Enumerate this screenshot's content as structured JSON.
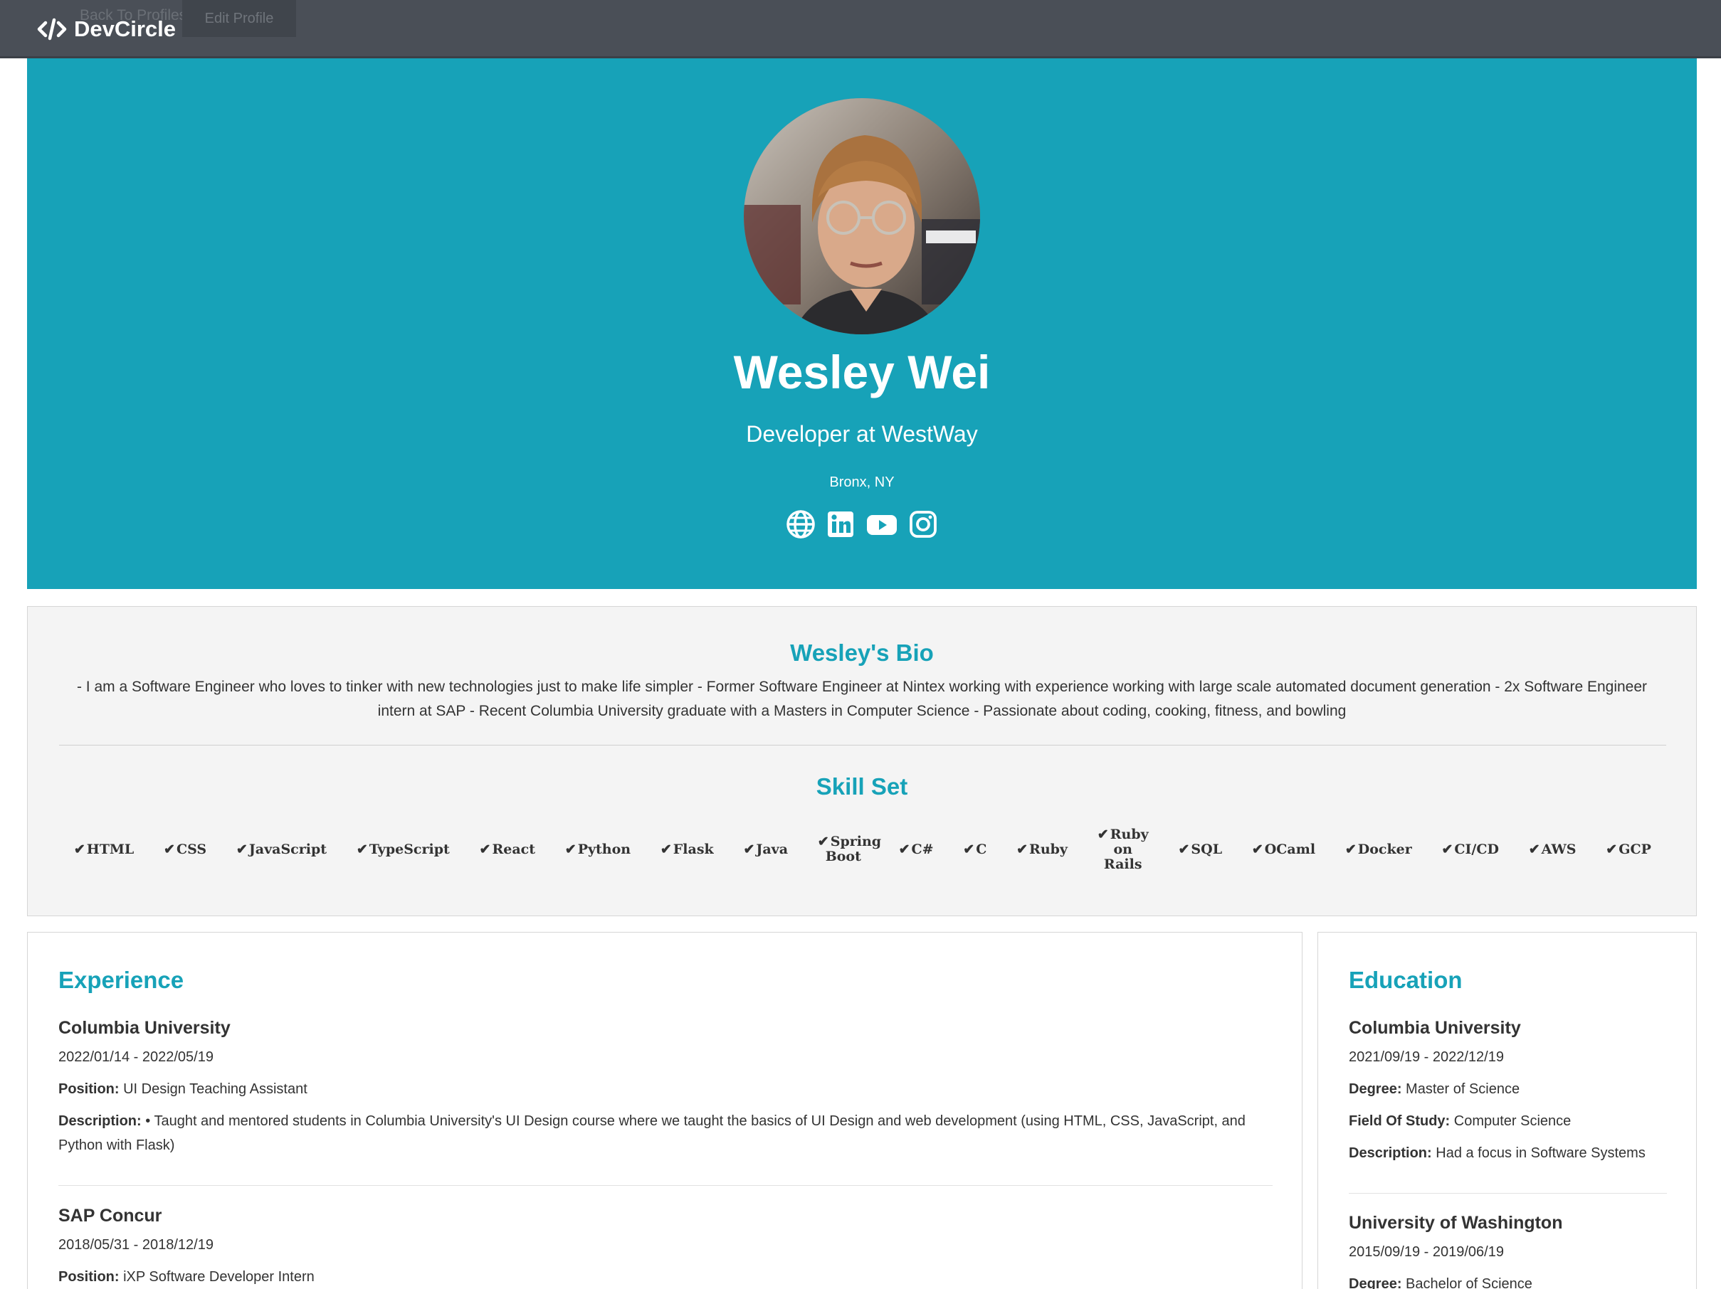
{
  "nav": {
    "brand": "DevCircle",
    "ghost_link": "Back To Profiles",
    "edit_button": "Edit Profile"
  },
  "profile": {
    "name": "Wesley Wei",
    "headline": "Developer at WestWay",
    "location": "Bronx, NY",
    "socials": [
      "globe-icon",
      "linkedin-icon",
      "youtube-icon",
      "instagram-icon"
    ]
  },
  "bio": {
    "title": "Wesley's Bio",
    "text": "- I am a Software Engineer who loves to tinker with new technologies just to make life simpler - Former Software Engineer at Nintex working with experience working with large scale automated document generation - 2x Software Engineer intern at SAP - Recent Columbia University graduate with a Masters in Computer Science - Passionate about coding, cooking, fitness, and bowling"
  },
  "skills": {
    "title": "Skill Set",
    "check": "✔",
    "items": [
      "HTML",
      "CSS",
      "JavaScript",
      "TypeScript",
      "React",
      "Python",
      "Flask",
      "Java",
      "Spring Boot",
      "C#",
      "C",
      "Ruby",
      "Ruby on Rails",
      "SQL",
      "OCaml",
      "Docker",
      "CI/CD",
      "AWS",
      "GCP"
    ]
  },
  "experience": {
    "title": "Experience",
    "position_label": "Position:",
    "description_label": "Description:",
    "items": [
      {
        "company": "Columbia University",
        "dates": "2022/01/14 - 2022/05/19",
        "position": "UI Design Teaching Assistant",
        "description": "• Taught and mentored students in Columbia University's UI Design course where we taught the basics of UI Design and web development (using HTML, CSS, JavaScript, and Python with Flask)"
      },
      {
        "company": "SAP Concur",
        "dates": "2018/05/31 - 2018/12/19",
        "position": "iXP Software Developer Intern"
      }
    ]
  },
  "education": {
    "title": "Education",
    "degree_label": "Degree:",
    "field_label": "Field Of Study:",
    "description_label": "Description:",
    "items": [
      {
        "school": "Columbia University",
        "dates": "2021/09/19 - 2022/12/19",
        "degree": "Master of Science",
        "field": "Computer Science",
        "description": "Had a focus in Software Systems"
      },
      {
        "school": "University of Washington",
        "dates": "2015/09/19 - 2019/06/19",
        "degree": "Bachelor of Science"
      }
    ]
  },
  "colors": {
    "accent": "#17a2b8",
    "navbar": "#4a4f57",
    "panel": "#f4f4f4"
  }
}
